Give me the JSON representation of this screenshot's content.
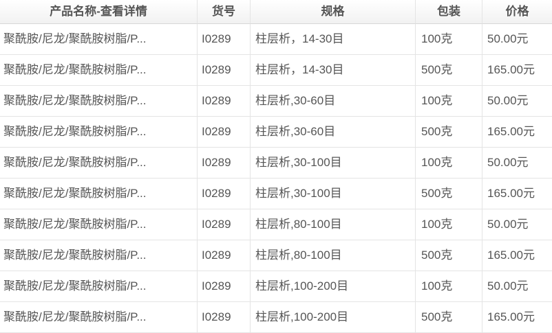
{
  "colors": {
    "text": "#555555",
    "grid_line": "#e4e4e4",
    "header_bg": "#f1f1f1"
  },
  "table": {
    "headers": {
      "name": "产品名称-查看详情",
      "sku": "货号",
      "spec": "规格",
      "package": "包装",
      "price": "价格"
    },
    "rows": [
      {
        "name": "聚酰胺/尼龙/聚酰胺树脂/P...",
        "sku": "I0289",
        "spec": "柱层析，14-30目",
        "package": "100克",
        "price": "50.00元"
      },
      {
        "name": "聚酰胺/尼龙/聚酰胺树脂/P...",
        "sku": "I0289",
        "spec": "柱层析，14-30目",
        "package": "500克",
        "price": "165.00元"
      },
      {
        "name": "聚酰胺/尼龙/聚酰胺树脂/P...",
        "sku": "I0289",
        "spec": "柱层析,30-60目",
        "package": "100克",
        "price": "50.00元"
      },
      {
        "name": "聚酰胺/尼龙/聚酰胺树脂/P...",
        "sku": "I0289",
        "spec": "柱层析,30-60目",
        "package": "500克",
        "price": "165.00元"
      },
      {
        "name": "聚酰胺/尼龙/聚酰胺树脂/P...",
        "sku": "I0289",
        "spec": "柱层析,30-100目",
        "package": "100克",
        "price": "50.00元"
      },
      {
        "name": "聚酰胺/尼龙/聚酰胺树脂/P...",
        "sku": "I0289",
        "spec": "柱层析,30-100目",
        "package": "500克",
        "price": "165.00元"
      },
      {
        "name": "聚酰胺/尼龙/聚酰胺树脂/P...",
        "sku": "I0289",
        "spec": "柱层析,80-100目",
        "package": "100克",
        "price": "50.00元"
      },
      {
        "name": "聚酰胺/尼龙/聚酰胺树脂/P...",
        "sku": "I0289",
        "spec": "柱层析,80-100目",
        "package": "500克",
        "price": "165.00元"
      },
      {
        "name": "聚酰胺/尼龙/聚酰胺树脂/P...",
        "sku": "I0289",
        "spec": "柱层析,100-200目",
        "package": "100克",
        "price": "50.00元"
      },
      {
        "name": "聚酰胺/尼龙/聚酰胺树脂/P...",
        "sku": "I0289",
        "spec": "柱层析,100-200目",
        "package": "500克",
        "price": "165.00元"
      }
    ]
  }
}
